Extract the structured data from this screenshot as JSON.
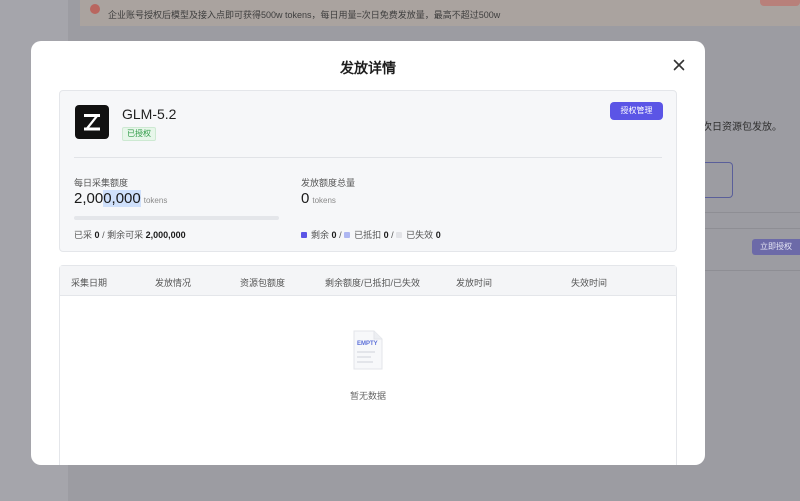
{
  "background": {
    "banner_text": "企业账号授权后模型及接入点即可获得500w tokens，每日用量=次日免费发放量，最高不超过500w",
    "right_text": "次日资源包发放。",
    "tag_label": "立即授权"
  },
  "modal": {
    "title": "发放详情",
    "model_name": "GLM-5.2",
    "auth_badge": "已授权",
    "manage_button": "授权管理",
    "daily_quota": {
      "label": "每日采集额度",
      "value_a": "2,00",
      "value_b": "0,000",
      "unit": "tokens",
      "progress": 0,
      "collected_label": "已采",
      "collected_value": "0",
      "remaining_label": "剩余可采",
      "remaining_value": "2,000,000"
    },
    "issued_total": {
      "label": "发放额度总量",
      "value": "0",
      "unit": "tokens",
      "legend": [
        {
          "label": "剩余",
          "value": "0",
          "color": "#5b55e6"
        },
        {
          "label": "已抵扣",
          "value": "0",
          "color": "#aeb7f2"
        },
        {
          "label": "已失效",
          "value": "0",
          "color": "#e2e3e7"
        }
      ]
    },
    "table": {
      "columns": [
        "采集日期",
        "发放情况",
        "资源包额度",
        "剩余额度/已抵扣/已失效",
        "发放时间",
        "失效时间"
      ],
      "empty_icon_text": "EMPTY",
      "empty_text": "暂无数据"
    }
  }
}
